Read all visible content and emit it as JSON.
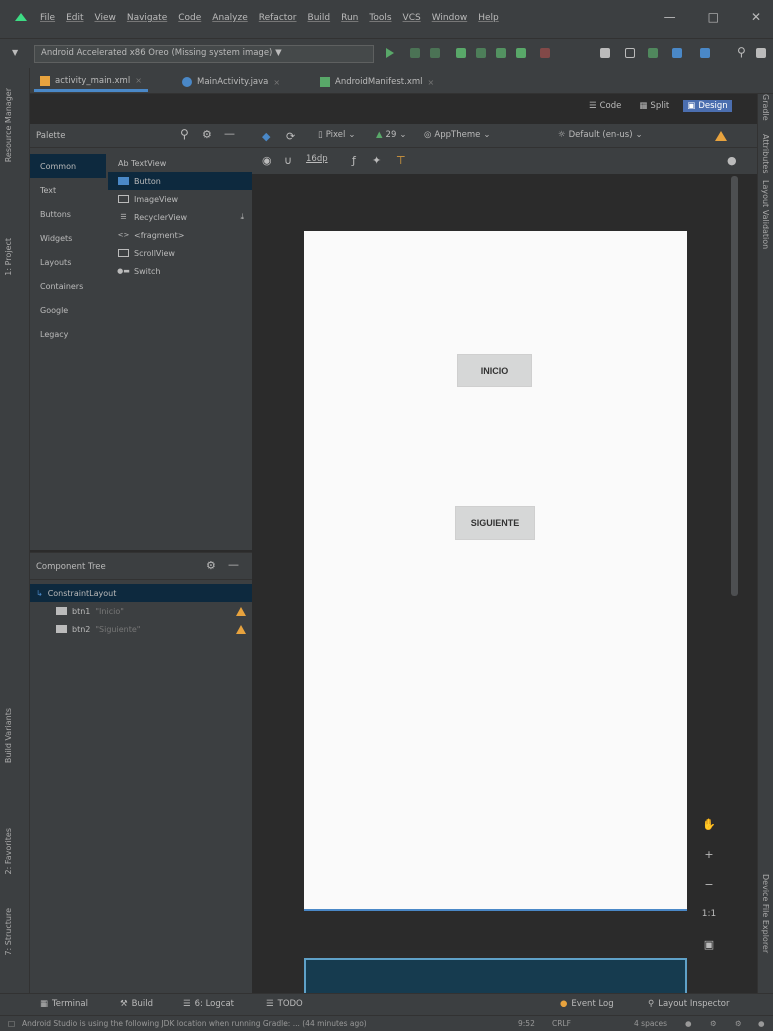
{
  "menu": {
    "items": [
      "File",
      "Edit",
      "View",
      "Navigate",
      "Code",
      "Analyze",
      "Refactor",
      "Build",
      "Run",
      "Tools",
      "VCS",
      "Window",
      "Help"
    ]
  },
  "toolbar": {
    "device": "Android Accelerated x86 Oreo (Missing system image)"
  },
  "tabs": [
    {
      "label": "activity_main.xml",
      "active": true
    },
    {
      "label": "MainActivity.java",
      "active": false
    },
    {
      "label": "AndroidManifest.xml",
      "active": false
    }
  ],
  "modes": {
    "code": "Code",
    "split": "Split",
    "design": "Design"
  },
  "palette": {
    "title": "Palette",
    "categories": [
      "Common",
      "Text",
      "Buttons",
      "Widgets",
      "Layouts",
      "Containers",
      "Google",
      "Legacy"
    ],
    "widgets": [
      "Ab TextView",
      "Button",
      "ImageView",
      "RecyclerView",
      "<fragment>",
      "ScrollView",
      "Switch"
    ]
  },
  "design_toolbar": {
    "device": "Pixel",
    "api": "29",
    "theme": "AppTheme",
    "locale": "Default (en-us)",
    "margin": "16dp"
  },
  "component_tree": {
    "title": "Component Tree",
    "root": "ConstraintLayout",
    "children": [
      {
        "id": "btn1",
        "text": "\"Inicio\""
      },
      {
        "id": "btn2",
        "text": "\"Siguiente\""
      }
    ]
  },
  "screen": {
    "button1": "INICIO",
    "button2": "SIGUIENTE"
  },
  "left_strip": [
    "Resource Manager",
    "1: Project",
    "Build Variants",
    "2: Favorites",
    "7: Structure"
  ],
  "right_strip": [
    "Gradle",
    "Attributes",
    "Layout Validation",
    "Device File Explorer"
  ],
  "bottom_tools": {
    "terminal": "Terminal",
    "build": "Build",
    "logcat": "6: Logcat",
    "todo": "TODO",
    "event_log": "Event Log",
    "layout_inspector": "Layout Inspector"
  },
  "status": {
    "message": "Android Studio is using the following JDK location when running Gradle: ... (44 minutes ago)",
    "position": "9:52",
    "encoding": "CRLF",
    "indent": "4 spaces"
  },
  "colors": {
    "accent": "#4a88c7",
    "warning": "#e8a33e",
    "panel": "#3c3f41",
    "editor": "#2b2b2b"
  }
}
